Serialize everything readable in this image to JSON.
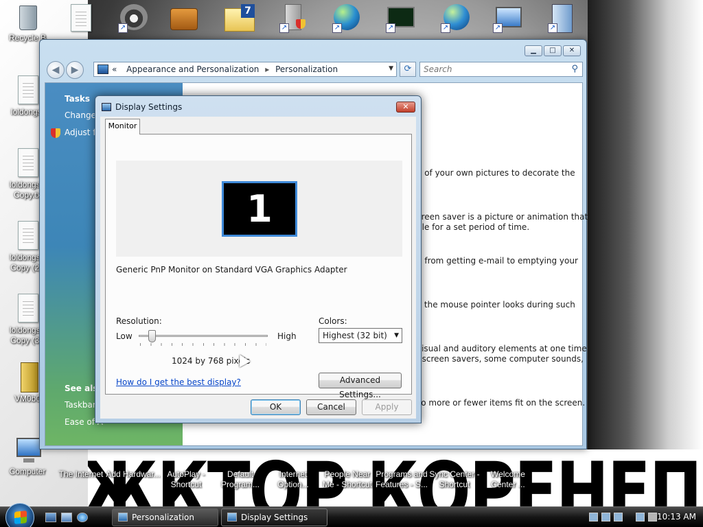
{
  "desktop": {
    "icons_left": [
      {
        "label": "Recycle B",
        "kind": "recycle"
      },
      {
        "label": "loldongs.",
        "kind": "doc"
      },
      {
        "label": "loldongs - Copy.tx",
        "kind": "doc"
      },
      {
        "label": "loldongs - Copy (2).",
        "kind": "doc"
      },
      {
        "label": "loldongs - Copy (3).",
        "kind": "doc"
      },
      {
        "label": "VM0b0",
        "kind": "archive"
      },
      {
        "label": "Computer",
        "kind": "computer"
      }
    ],
    "icons_bottom": [
      {
        "label": "The Internet"
      },
      {
        "label": "Add Hardwar..."
      },
      {
        "label": "AutoPlay - Shortcut"
      },
      {
        "label": "Default Program..."
      },
      {
        "label": "Internet Option..."
      },
      {
        "label": "People Near Me - Shortcut"
      },
      {
        "label": "Programs and Features - S..."
      },
      {
        "label": "Sync Center - Shortcut"
      },
      {
        "label": "Welcome Center ..."
      }
    ],
    "wallpaper_text": "ЖКТОР КОРЕНЕП"
  },
  "personalization": {
    "address": {
      "prefix": "«",
      "crumbs": [
        "Appearance and Personalization",
        "Personalization"
      ]
    },
    "search_placeholder": "Search",
    "left_pane": {
      "tasks_header": "Tasks",
      "task_links": [
        "Change d",
        "Adjust fo"
      ],
      "see_also_header": "See also",
      "see_also_links": [
        "Taskbar a",
        "Ease of A"
      ]
    },
    "descriptions": [
      "e of your own pictures to decorate the",
      "creen saver is a picture or animation that",
      "dle for a set period of time.",
      "g from getting e-mail to emptying your",
      "v the mouse pointer looks during such",
      "visual and auditory elements at one time",
      ", screen savers, some computer sounds,",
      "so more or fewer items fit on the screen."
    ]
  },
  "dialog": {
    "title": "Display Settings",
    "close_glyph": "✕",
    "tab_label": "Monitor",
    "monitor_number": "1",
    "monitor_name": "Generic PnP Monitor on Standard VGA Graphics Adapter",
    "resolution_label": "Resolution:",
    "low_label": "Low",
    "high_label": "High",
    "resolution_value": "1024 by 768 pixels",
    "colors_label": "Colors:",
    "colors_value": "Highest (32 bit)",
    "help_link": "How do I get the best display?",
    "advanced_button": "Advanced Settings...",
    "ok_button": "OK",
    "cancel_button": "Cancel",
    "apply_button": "Apply"
  },
  "taskbar": {
    "buttons": [
      "Personalization",
      "Display Settings"
    ],
    "clock": "10:13 AM"
  },
  "colors": {
    "taskbar": "#1a1a1a",
    "link": "#0645c9",
    "selection_border": "#3f8ad9"
  }
}
